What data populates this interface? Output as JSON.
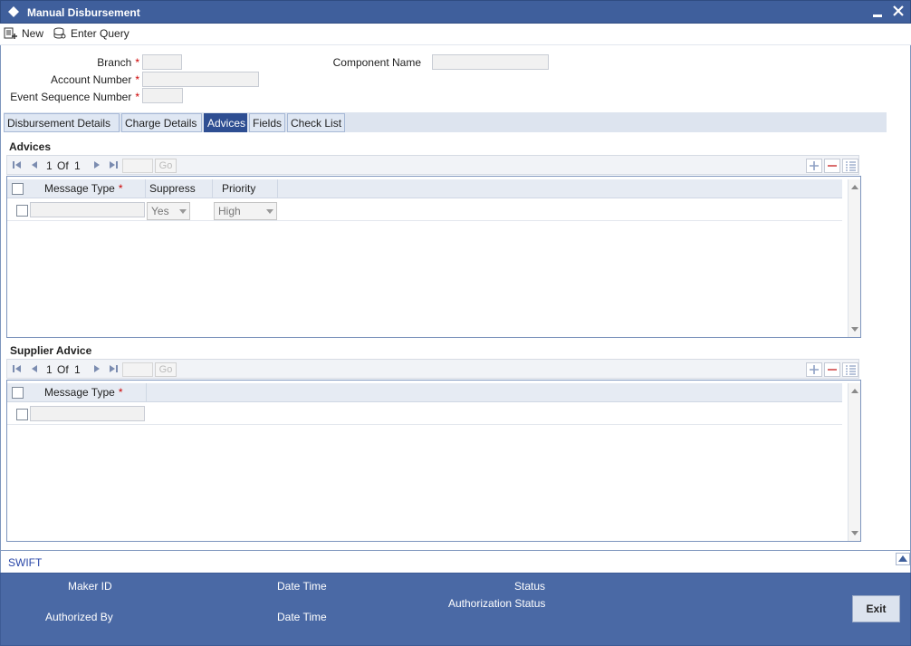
{
  "window": {
    "title": "Manual Disbursement"
  },
  "toolbar": {
    "new_label": "New",
    "enter_query_label": "Enter Query"
  },
  "header": {
    "branch_label": "Branch",
    "account_number_label": "Account Number",
    "event_sequence_label": "Event Sequence Number",
    "component_name_label": "Component Name",
    "required_mark": "*",
    "branch_value": "",
    "account_number_value": "",
    "event_sequence_value": "",
    "component_name_value": ""
  },
  "tabs": [
    {
      "label": "Disbursement Details",
      "active": false
    },
    {
      "label": "Charge Details",
      "active": false
    },
    {
      "label": "Advices",
      "active": true
    },
    {
      "label": "Fields",
      "active": false
    },
    {
      "label": "Check List",
      "active": false
    }
  ],
  "advices": {
    "title": "Advices",
    "pager": {
      "current": "1",
      "of_label": "Of",
      "total": "1",
      "go_label": "Go"
    },
    "columns": {
      "message_type": "Message Type",
      "suppress": "Suppress",
      "priority": "Priority"
    },
    "rows": [
      {
        "message_type": "",
        "suppress": "Yes",
        "priority": "High"
      }
    ]
  },
  "supplier_advice": {
    "title": "Supplier Advice",
    "pager": {
      "current": "1",
      "of_label": "Of",
      "total": "1",
      "go_label": "Go"
    },
    "columns": {
      "message_type": "Message Type"
    },
    "rows": [
      {
        "message_type": ""
      }
    ]
  },
  "swift": {
    "label": "SWIFT"
  },
  "footer": {
    "maker_id_label": "Maker ID",
    "date_time_label": "Date Time",
    "status_label": "Status",
    "authorization_status_label": "Authorization Status",
    "authorized_by_label": "Authorized By",
    "date_time_label_2": "Date Time",
    "exit_label": "Exit"
  },
  "colors": {
    "titlebar": "#3f5f9c",
    "active_tab": "#2e4e92",
    "footer": "#4a69a5",
    "required": "#cc0000"
  }
}
